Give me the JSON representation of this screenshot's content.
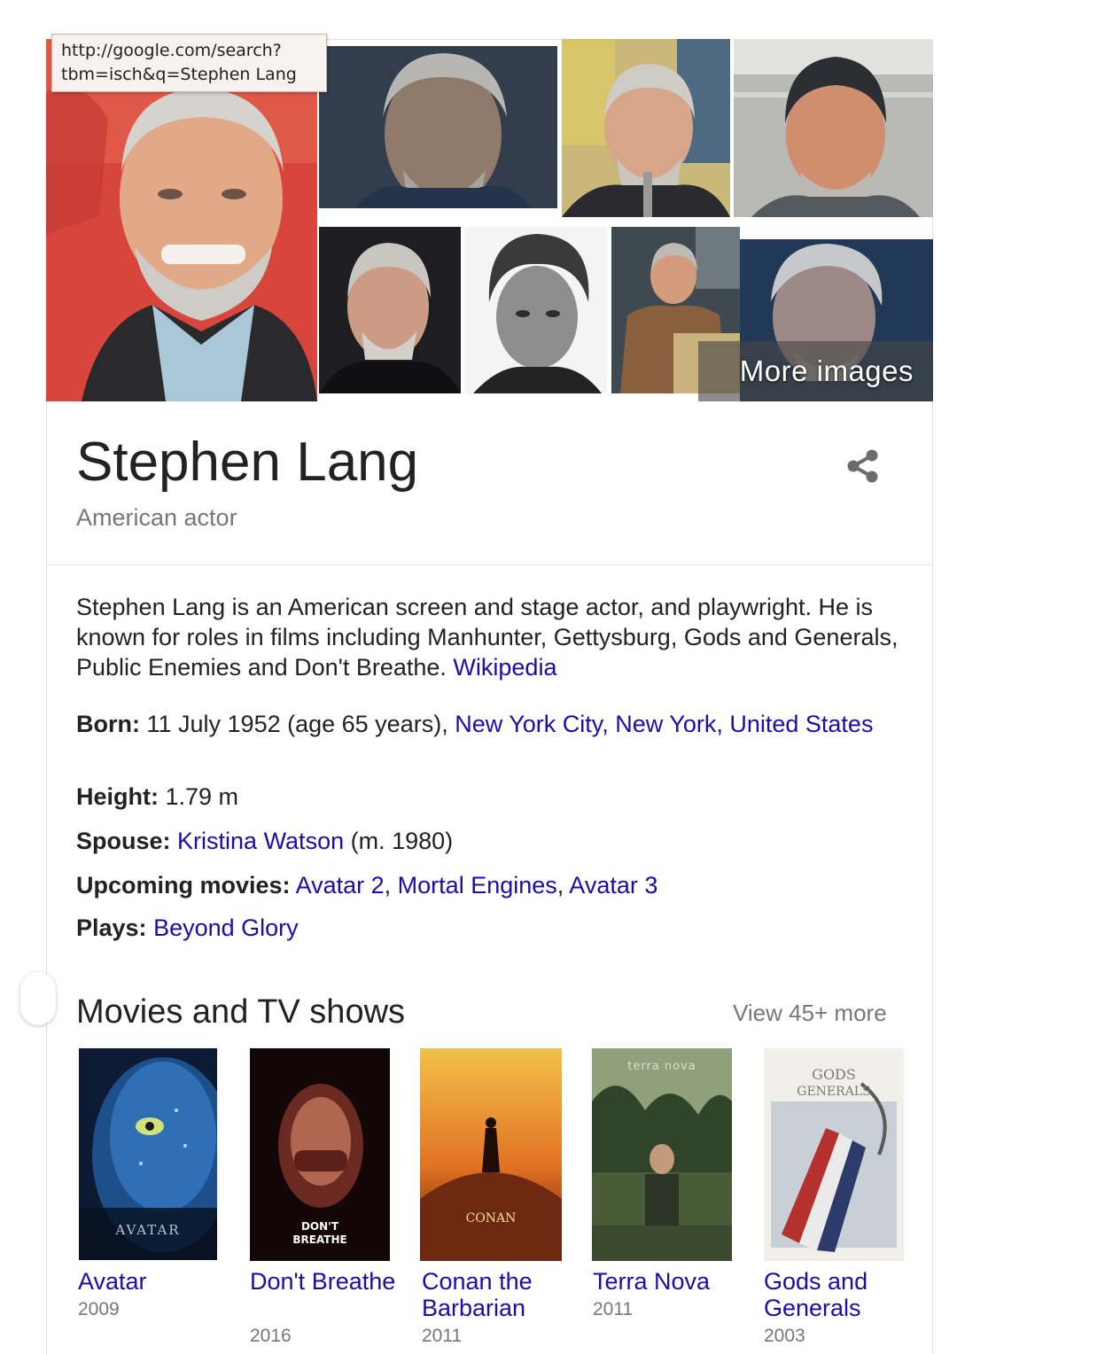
{
  "tooltip": {
    "line1": "http://google.com/search?",
    "line2": "tbm=isch&q=Stephen Lang"
  },
  "images": {
    "more_label": "More images"
  },
  "entity": {
    "name": "Stephen Lang",
    "subtitle": "American actor"
  },
  "description": {
    "text": "Stephen Lang is an American screen and stage actor, and playwright. He is known for roles in films including Manhunter, Gettysburg, Gods and Generals, Public Enemies and Don't Breathe.",
    "source": "Wikipedia"
  },
  "facts": {
    "born": {
      "label": "Born:",
      "value": "11 July 1952 (age 65 years),",
      "place": "New York City, New York, United States"
    },
    "height": {
      "label": "Height:",
      "value": "1.79 m"
    },
    "spouse": {
      "label": "Spouse:",
      "link": "Kristina Watson",
      "extra": "(m. 1980)"
    },
    "upcoming": {
      "label": "Upcoming movies:",
      "m1": "Avatar 2",
      "m2": "Mortal Engines",
      "m3": "Avatar 3",
      "sep": ","
    },
    "plays": {
      "label": "Plays:",
      "link": "Beyond Glory"
    }
  },
  "movies_section": {
    "title": "Movies and TV shows",
    "view_more": "View 45+ more",
    "items": [
      {
        "title": "Avatar",
        "year": "2009",
        "poster_text": "AVATAR"
      },
      {
        "title": "Don't Breathe",
        "year": "2016",
        "poster_text": "DON'T BREATHE"
      },
      {
        "title": "Conan the Barbarian",
        "year": "2011",
        "poster_text": "CONAN"
      },
      {
        "title": "Terra Nova",
        "year": "2011",
        "poster_text": "terra nova"
      },
      {
        "title": "Gods and Generals",
        "year": "2003",
        "poster_text": "GODS GENERALS"
      }
    ]
  },
  "colors": {
    "link": "#1a0dab",
    "secondary_text": "#777777",
    "primary_text": "#222222"
  }
}
